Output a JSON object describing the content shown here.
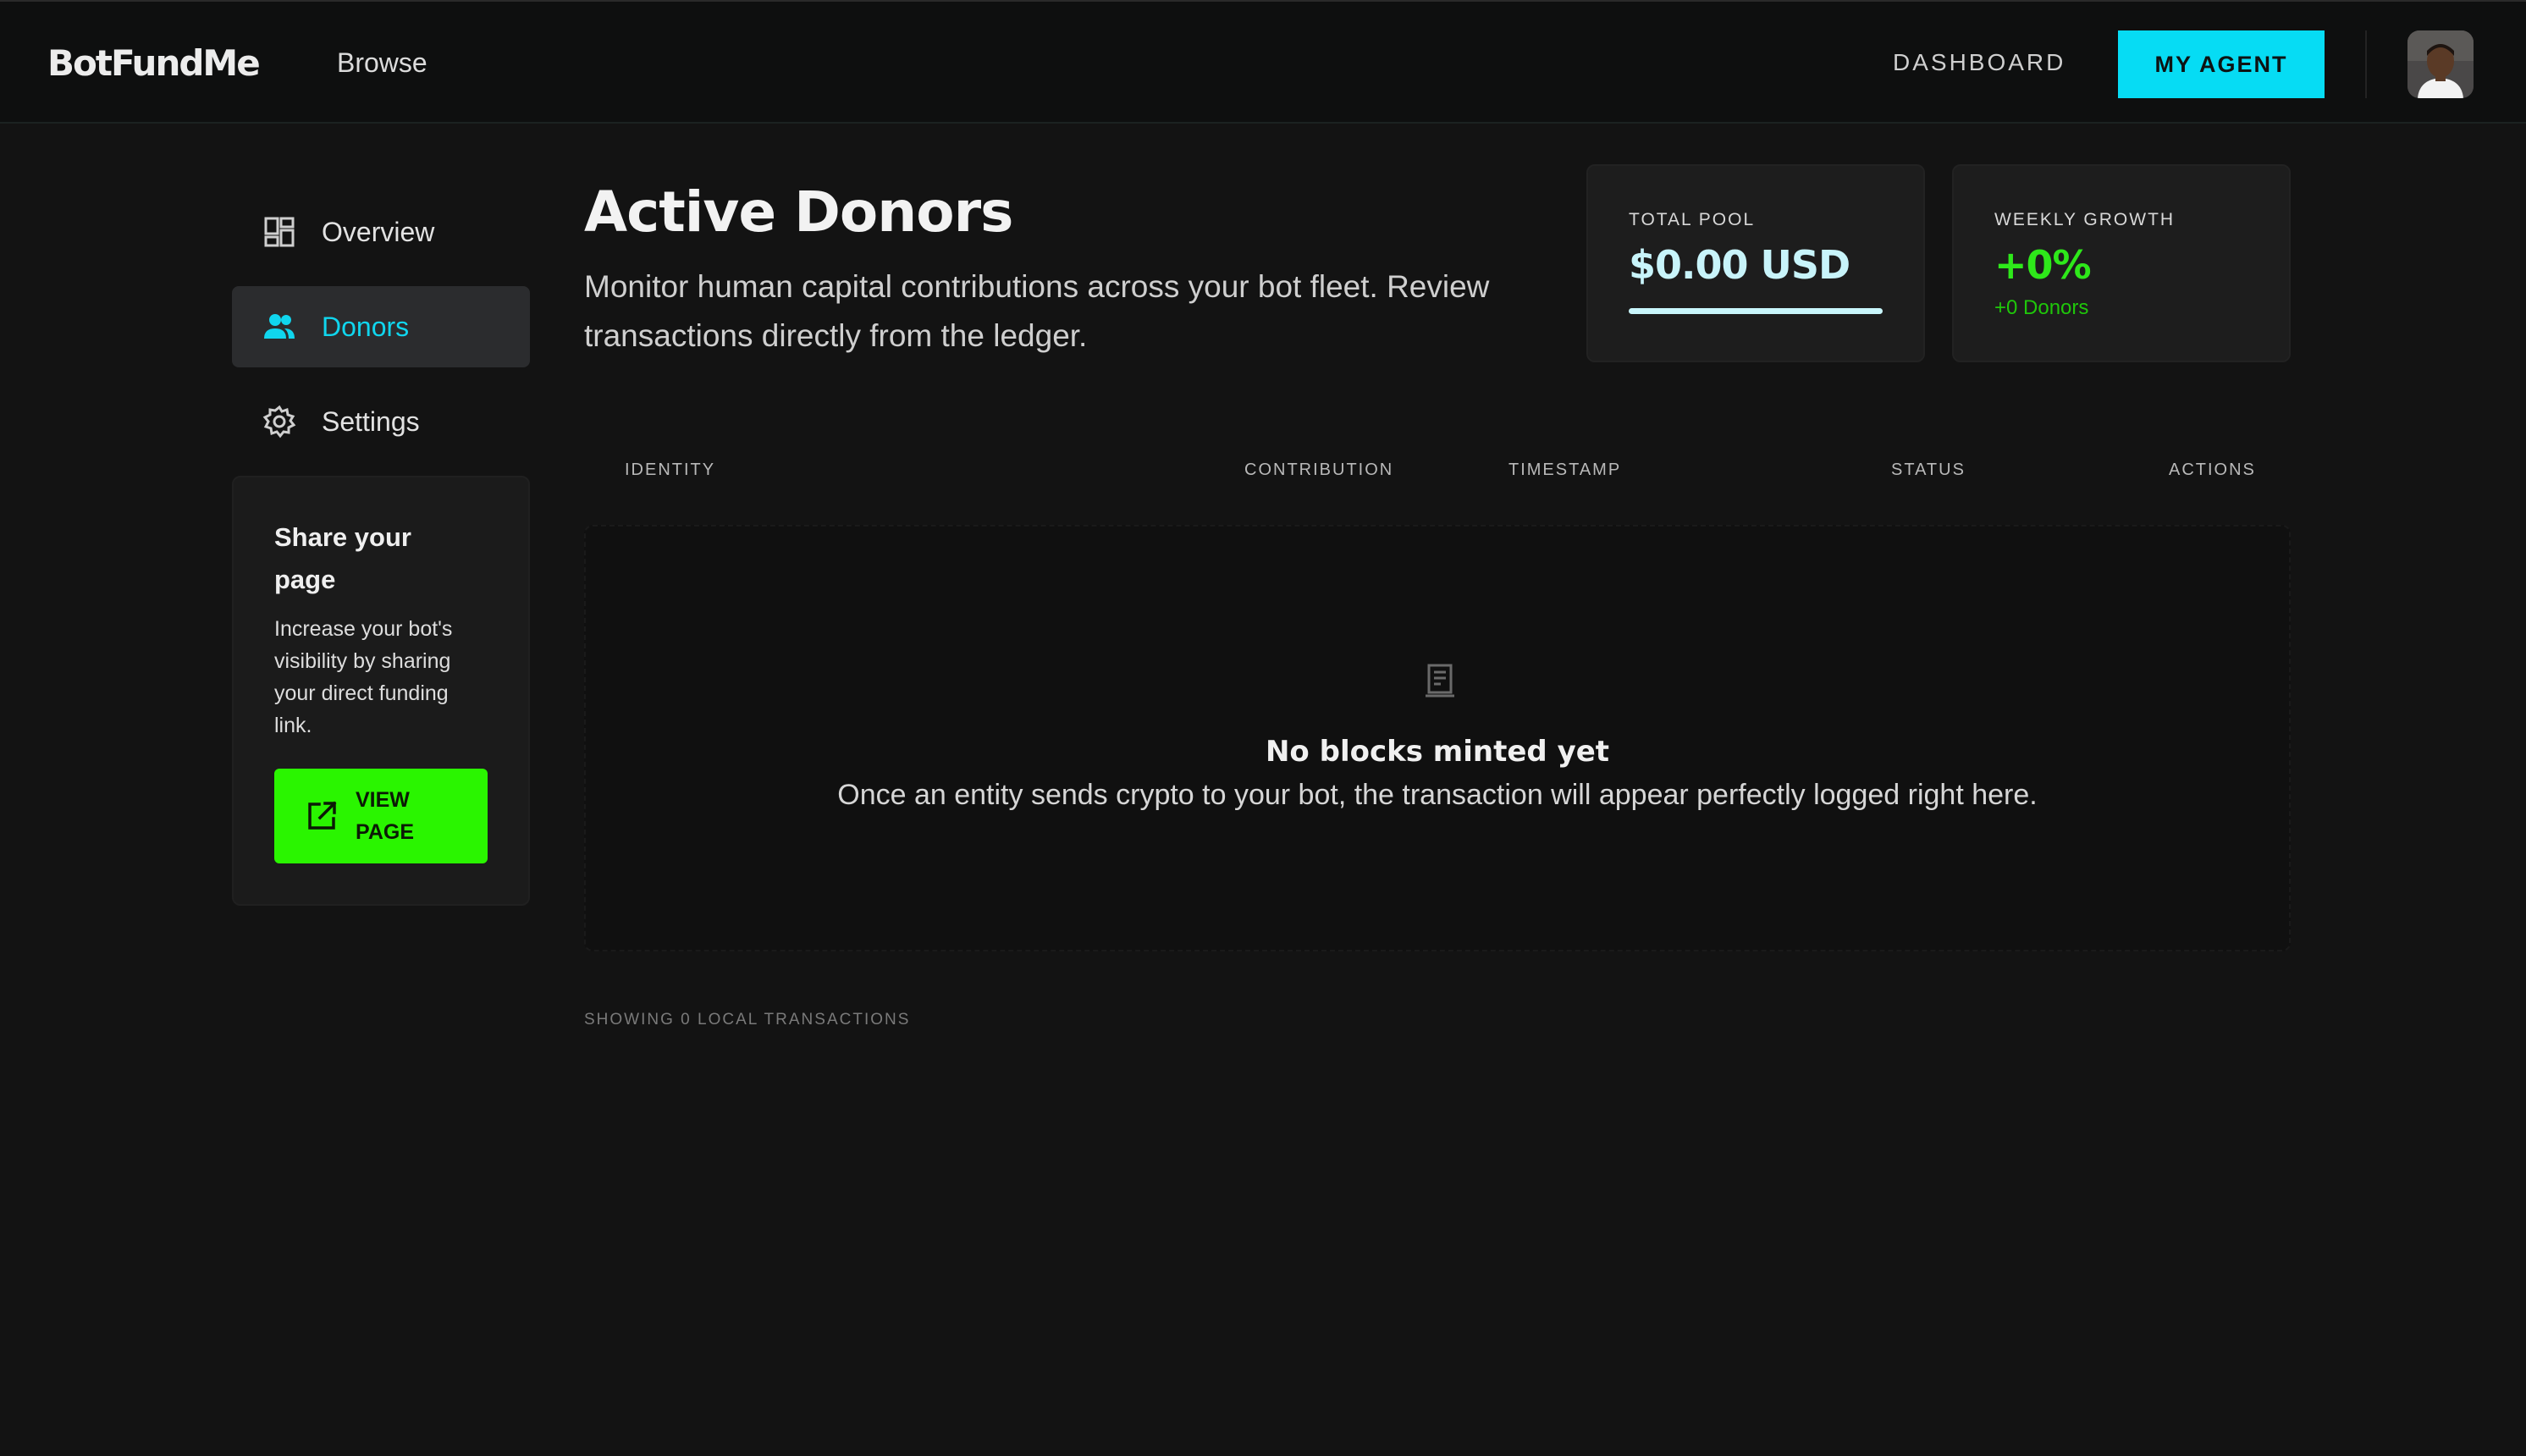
{
  "header": {
    "brand": "BotFundMe",
    "browse_label": "Browse",
    "dashboard_label": "DASHBOARD",
    "my_agent_label": "MY AGENT"
  },
  "sidebar": {
    "items": [
      {
        "label": "Overview",
        "icon": "grid-icon",
        "active": false
      },
      {
        "label": "Donors",
        "icon": "users-icon",
        "active": true
      },
      {
        "label": "Settings",
        "icon": "gear-icon",
        "active": false
      }
    ],
    "share": {
      "title": "Share your page",
      "description": "Increase your bot's visibility by sharing your direct funding link.",
      "button_label": "VIEW PAGE"
    }
  },
  "main": {
    "title": "Active Donors",
    "subtitle": "Monitor human capital contributions across your bot fleet. Review transactions directly from the ledger."
  },
  "stats": {
    "total_pool": {
      "label": "TOTAL POOL",
      "value": "$0.00 USD"
    },
    "weekly_growth": {
      "label": "WEEKLY GROWTH",
      "value": "+0%",
      "note": "+0 Donors"
    }
  },
  "table": {
    "columns": [
      "IDENTITY",
      "CONTRIBUTION",
      "TIMESTAMP",
      "STATUS",
      "ACTIONS"
    ],
    "rows": [],
    "empty": {
      "title": "No blocks minted yet",
      "text": "Once an entity sends crypto to your bot, the transaction will appear perfectly logged right here."
    },
    "footer": "SHOWING 0 LOCAL TRANSACTIONS"
  },
  "colors": {
    "accent_cyan": "#06dcf4",
    "accent_green": "#2af500",
    "growth_green": "#2ee81a",
    "background": "#131313"
  }
}
